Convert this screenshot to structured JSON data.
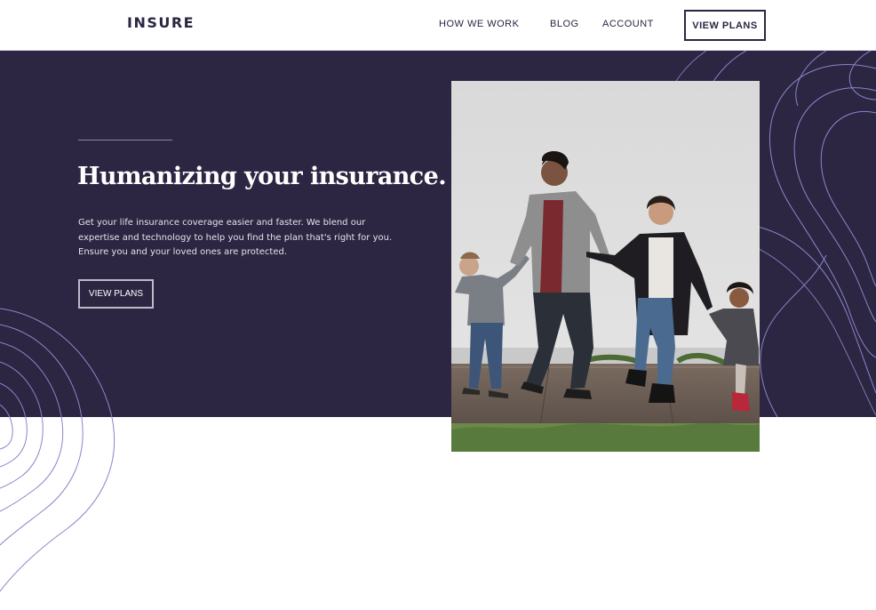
{
  "brand": {
    "logo_text": "INSURE"
  },
  "nav": {
    "links": [
      {
        "label": "HOW WE WORK"
      },
      {
        "label": "BLOG"
      },
      {
        "label": "ACCOUNT"
      }
    ],
    "cta_label": "VIEW PLANS"
  },
  "hero": {
    "title": "Humanizing your insurance.",
    "body": "Get your life insurance coverage easier and faster. We blend our expertise and technology to help you find the plan that's right for you. Ensure you and your loved ones are protected.",
    "cta_label": "VIEW PLANS",
    "image_subject": "family-walking-photo"
  },
  "colors": {
    "hero_background": "#2c2642",
    "text_dark": "#2c2541",
    "pattern_stroke": "#8b86c9"
  }
}
